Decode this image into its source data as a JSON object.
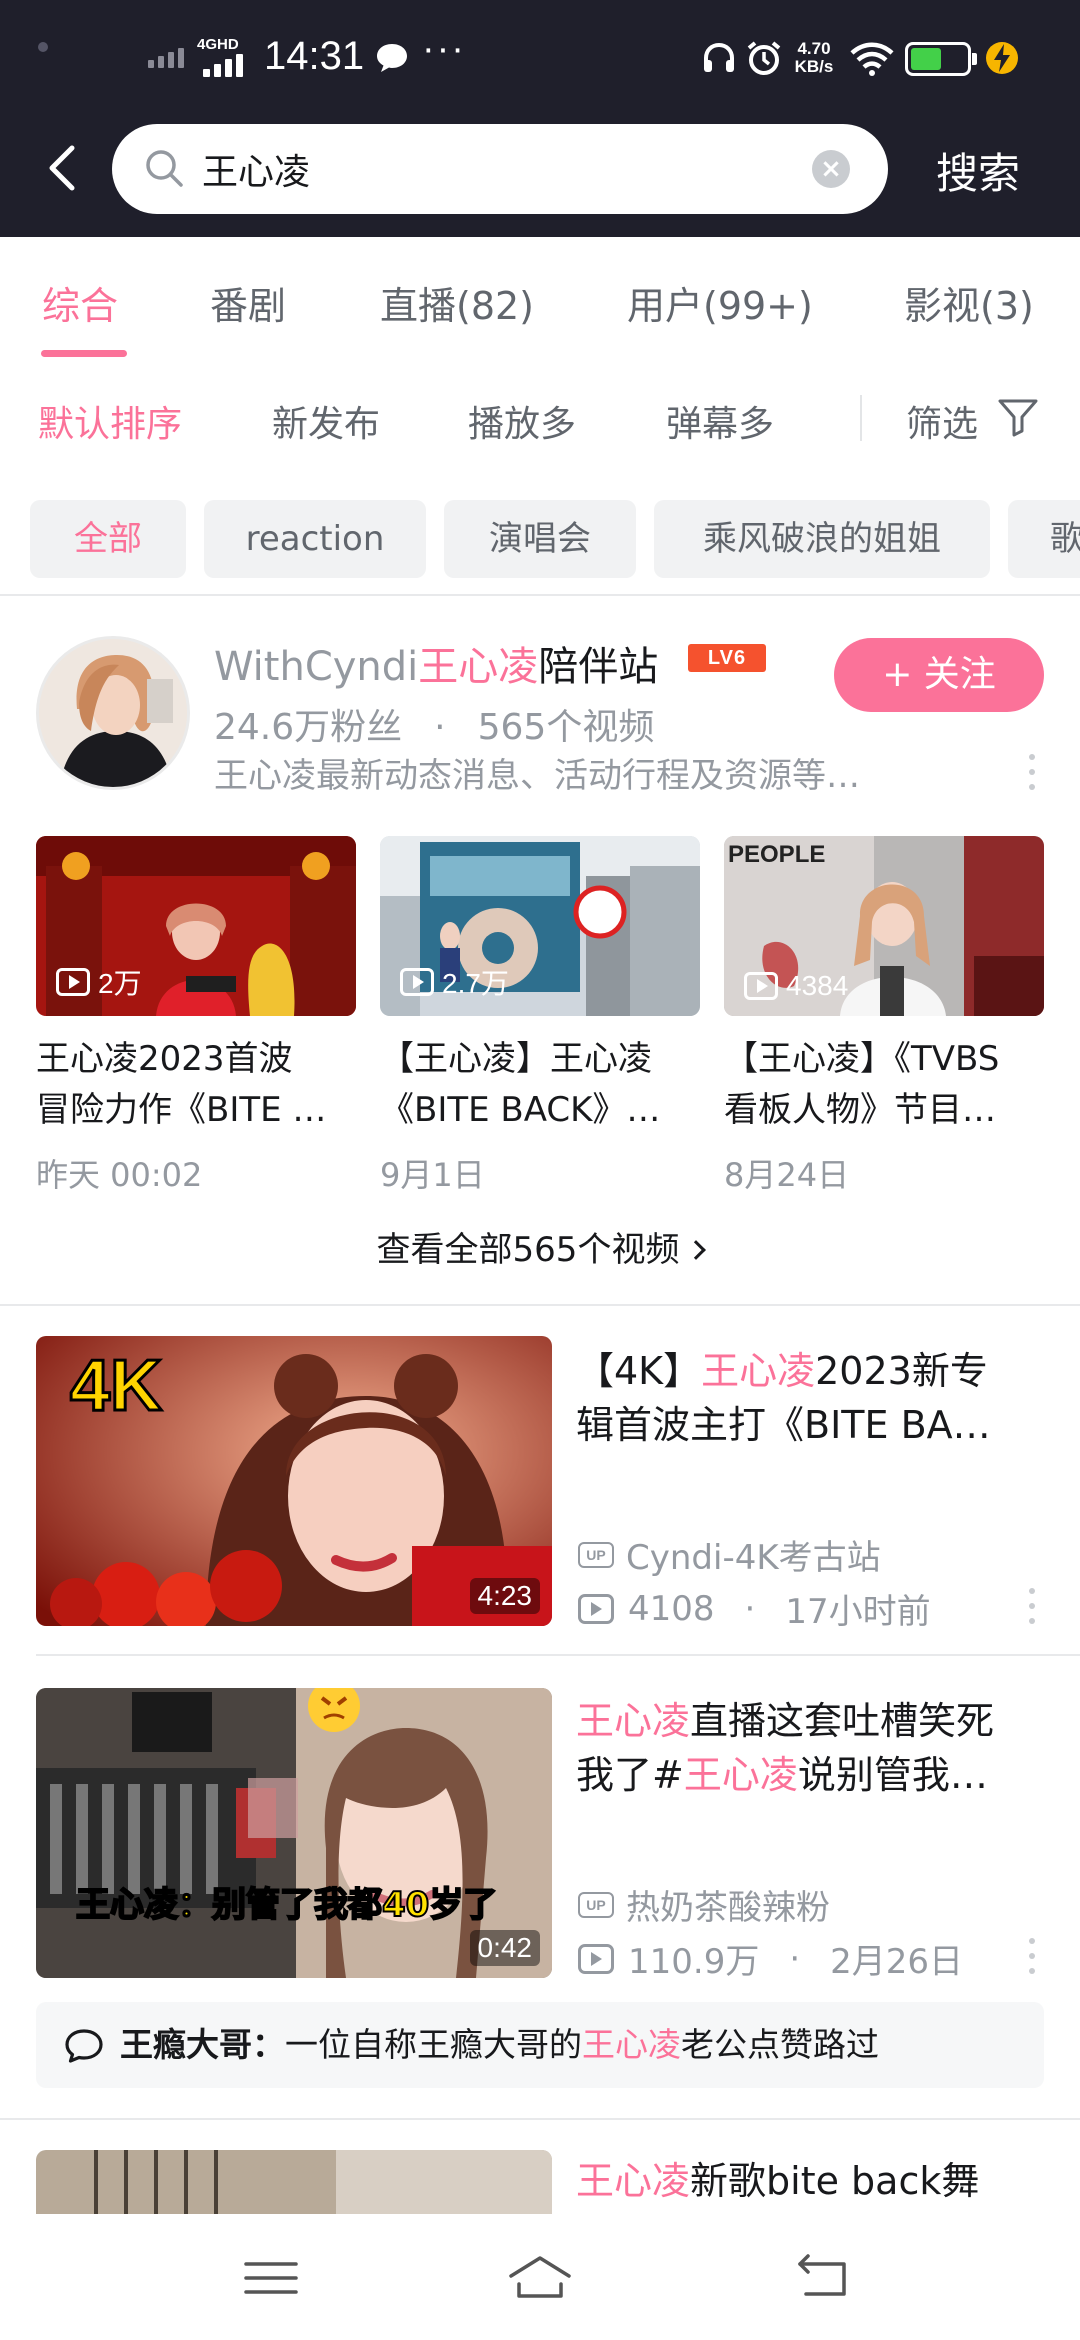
{
  "status_bar": {
    "network": "4GHD",
    "time": "14:31",
    "speed_value": "4.70",
    "speed_unit": "KB/s",
    "battery_level": 0.55,
    "icons": [
      "chat-bubble-icon",
      "headphone-icon",
      "alarm-icon",
      "wifi-icon",
      "battery-icon",
      "charging-icon"
    ]
  },
  "search": {
    "query": "王心凌",
    "submit_label": "搜索"
  },
  "tabs": [
    {
      "label": "综合",
      "active": true
    },
    {
      "label": "番剧"
    },
    {
      "label": "直播(82)"
    },
    {
      "label": "用户(99+)"
    },
    {
      "label": "影视(3)"
    }
  ],
  "sort": {
    "options": [
      "默认排序",
      "新发布",
      "播放多",
      "弹幕多"
    ],
    "active": "默认排序",
    "filter_label": "筛选"
  },
  "chips": [
    "全部",
    "reaction",
    "演唱会",
    "乘风破浪的姐姐",
    "歌"
  ],
  "user_card": {
    "name_prefix": "WithCyndi",
    "name_highlight": "王心凌",
    "name_suffix": "陪伴站",
    "level_badge": "LV6",
    "follow_label": "+ 关注",
    "fans": "24.6万粉丝",
    "separator": "·",
    "videos": "565个视频",
    "description": "王心凌最新动态消息、活动行程及资源等…",
    "mini_videos": [
      {
        "views": "2万",
        "title_line1": "王心凌2023首波",
        "title_line2": "冒险力作《BITE …",
        "date": "昨天  00:02"
      },
      {
        "views": "2.7万",
        "title_line1": "【王心凌】王心凌",
        "title_line2": "《BITE BACK》…",
        "date": "9月1日"
      },
      {
        "views": "4384",
        "title_line1": "【王心凌】《TVBS",
        "title_line2": "看板人物》节目…",
        "date": "8月24日"
      }
    ],
    "mini_thumb_text": [
      "PEOPLE"
    ],
    "view_all": "查看全部565个视频"
  },
  "videos": [
    {
      "thumb_overlay": "4K",
      "duration": "4:23",
      "title_line1_a": "【4K】",
      "title_line1_hl": "王心凌",
      "title_line1_b": "2023新专",
      "title_line2": "辑首波主打《BITE BA…",
      "up_badge": "UP",
      "uploader": "Cyndi-4K考古站",
      "views": "4108",
      "dot": "·",
      "time": "17小时前"
    },
    {
      "thumb_caption": "王心凌：别管了我都40岁了",
      "duration": "0:42",
      "title_line1_hl": "王心凌",
      "title_line1_b": "直播这套吐槽笑死",
      "title_line2_a": "我了#",
      "title_line2_hl": "王心凌",
      "title_line2_b": "说别管我…",
      "up_badge": "UP",
      "uploader": "热奶茶酸辣粉",
      "views": "110.9万",
      "dot": "·",
      "time": "2月26日",
      "comment_author": "王瘾大哥：",
      "comment_a": "一位自称王瘾大哥的",
      "comment_hl": "王心凌",
      "comment_b": "老公点赞路过"
    },
    {
      "title_line1_hl": "王心凌",
      "title_line1_b": "新歌bite  back舞"
    }
  ],
  "colors": {
    "header_bg": "#1f1f2b",
    "accent_pink": "#fb7299",
    "text_gray": "#9499a0",
    "chip_bg": "#f1f2f3",
    "battery_green": "#43d049",
    "level_badge": "#f5522e"
  },
  "nav_icons": [
    "menu-icon",
    "home-icon",
    "back-icon"
  ]
}
